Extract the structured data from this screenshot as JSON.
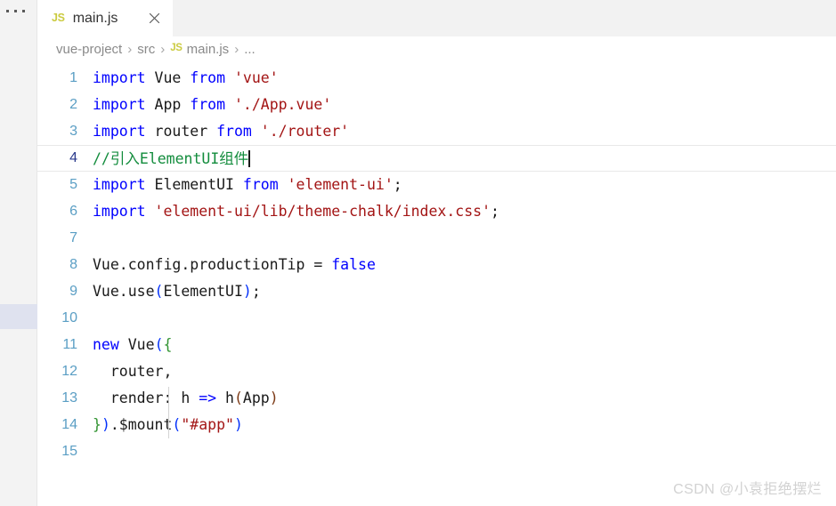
{
  "window": {
    "rail_overflow_label": "...",
    "rail_dots_count": 3
  },
  "tab": {
    "file_icon": "js-file-icon",
    "file_icon_label": "JS",
    "label": "main.js",
    "close_icon": "close-icon"
  },
  "breadcrumb": {
    "separator": "›",
    "items": [
      {
        "label": "vue-project",
        "icon": null
      },
      {
        "label": "src",
        "icon": null
      },
      {
        "label": "main.js",
        "icon": "JS"
      },
      {
        "label": "...",
        "icon": null
      }
    ]
  },
  "editor": {
    "active_line": 4,
    "cursor_line": 4,
    "cursor_column": 15,
    "lines": [
      {
        "num": "1",
        "tokens": [
          {
            "t": "import",
            "c": "kw"
          },
          {
            "t": " ",
            "c": "plain"
          },
          {
            "t": "Vue",
            "c": "plain"
          },
          {
            "t": " ",
            "c": "plain"
          },
          {
            "t": "from",
            "c": "kw"
          },
          {
            "t": " ",
            "c": "plain"
          },
          {
            "t": "'vue'",
            "c": "str"
          }
        ]
      },
      {
        "num": "2",
        "tokens": [
          {
            "t": "import",
            "c": "kw"
          },
          {
            "t": " ",
            "c": "plain"
          },
          {
            "t": "App",
            "c": "plain"
          },
          {
            "t": " ",
            "c": "plain"
          },
          {
            "t": "from",
            "c": "kw"
          },
          {
            "t": " ",
            "c": "plain"
          },
          {
            "t": "'./App.vue'",
            "c": "str"
          }
        ]
      },
      {
        "num": "3",
        "tokens": [
          {
            "t": "import",
            "c": "kw"
          },
          {
            "t": " ",
            "c": "plain"
          },
          {
            "t": "router",
            "c": "plain"
          },
          {
            "t": " ",
            "c": "plain"
          },
          {
            "t": "from",
            "c": "kw"
          },
          {
            "t": " ",
            "c": "plain"
          },
          {
            "t": "'./router'",
            "c": "str"
          }
        ]
      },
      {
        "num": "4",
        "tokens": [
          {
            "t": "//引入ElementUI组件",
            "c": "cmt"
          }
        ]
      },
      {
        "num": "5",
        "tokens": [
          {
            "t": "import",
            "c": "kw"
          },
          {
            "t": " ",
            "c": "plain"
          },
          {
            "t": "ElementUI",
            "c": "plain"
          },
          {
            "t": " ",
            "c": "plain"
          },
          {
            "t": "from",
            "c": "kw"
          },
          {
            "t": " ",
            "c": "plain"
          },
          {
            "t": "'element-ui'",
            "c": "str"
          },
          {
            "t": ";",
            "c": "plain"
          }
        ]
      },
      {
        "num": "6",
        "tokens": [
          {
            "t": "import",
            "c": "kw"
          },
          {
            "t": " ",
            "c": "plain"
          },
          {
            "t": "'element-ui/lib/theme-chalk/index.css'",
            "c": "str"
          },
          {
            "t": ";",
            "c": "plain"
          }
        ]
      },
      {
        "num": "7",
        "tokens": []
      },
      {
        "num": "8",
        "tokens": [
          {
            "t": "Vue.config.productionTip ",
            "c": "plain"
          },
          {
            "t": "=",
            "c": "plain"
          },
          {
            "t": " ",
            "c": "plain"
          },
          {
            "t": "false",
            "c": "kw"
          }
        ]
      },
      {
        "num": "9",
        "tokens": [
          {
            "t": "Vue.use",
            "c": "plain"
          },
          {
            "t": "(",
            "c": "br1"
          },
          {
            "t": "ElementUI",
            "c": "plain"
          },
          {
            "t": ")",
            "c": "br1"
          },
          {
            "t": ";",
            "c": "plain"
          }
        ]
      },
      {
        "num": "10",
        "tokens": []
      },
      {
        "num": "11",
        "tokens": [
          {
            "t": "new",
            "c": "kw"
          },
          {
            "t": " ",
            "c": "plain"
          },
          {
            "t": "Vue",
            "c": "plain"
          },
          {
            "t": "(",
            "c": "br1"
          },
          {
            "t": "{",
            "c": "br2"
          }
        ]
      },
      {
        "num": "12",
        "tokens": [
          {
            "t": "  router,",
            "c": "plain"
          }
        ]
      },
      {
        "num": "13",
        "tokens": [
          {
            "t": "  render: h ",
            "c": "plain"
          },
          {
            "t": "=>",
            "c": "op"
          },
          {
            "t": " h",
            "c": "plain"
          },
          {
            "t": "(",
            "c": "br3"
          },
          {
            "t": "App",
            "c": "plain"
          },
          {
            "t": ")",
            "c": "br3"
          }
        ]
      },
      {
        "num": "14",
        "tokens": [
          {
            "t": "}",
            "c": "br2"
          },
          {
            "t": ")",
            "c": "br1"
          },
          {
            "t": ".$mount",
            "c": "plain"
          },
          {
            "t": "(",
            "c": "br1"
          },
          {
            "t": "\"#app\"",
            "c": "str"
          },
          {
            "t": ")",
            "c": "br1"
          }
        ]
      },
      {
        "num": "15",
        "tokens": []
      }
    ]
  },
  "watermark": {
    "text": "CSDN @小袁拒绝摆烂"
  },
  "colors": {
    "keyword": "#0000ff",
    "string": "#a31515",
    "comment": "#128c3c",
    "line_number": "#5a9ec4",
    "active_line_number": "#2a3a8c",
    "rail_highlight": "#dfe2ef",
    "tabbar_bg": "#f2f2f2",
    "rail_bg": "#f3f3f3",
    "js_icon": "#cbcb41"
  }
}
